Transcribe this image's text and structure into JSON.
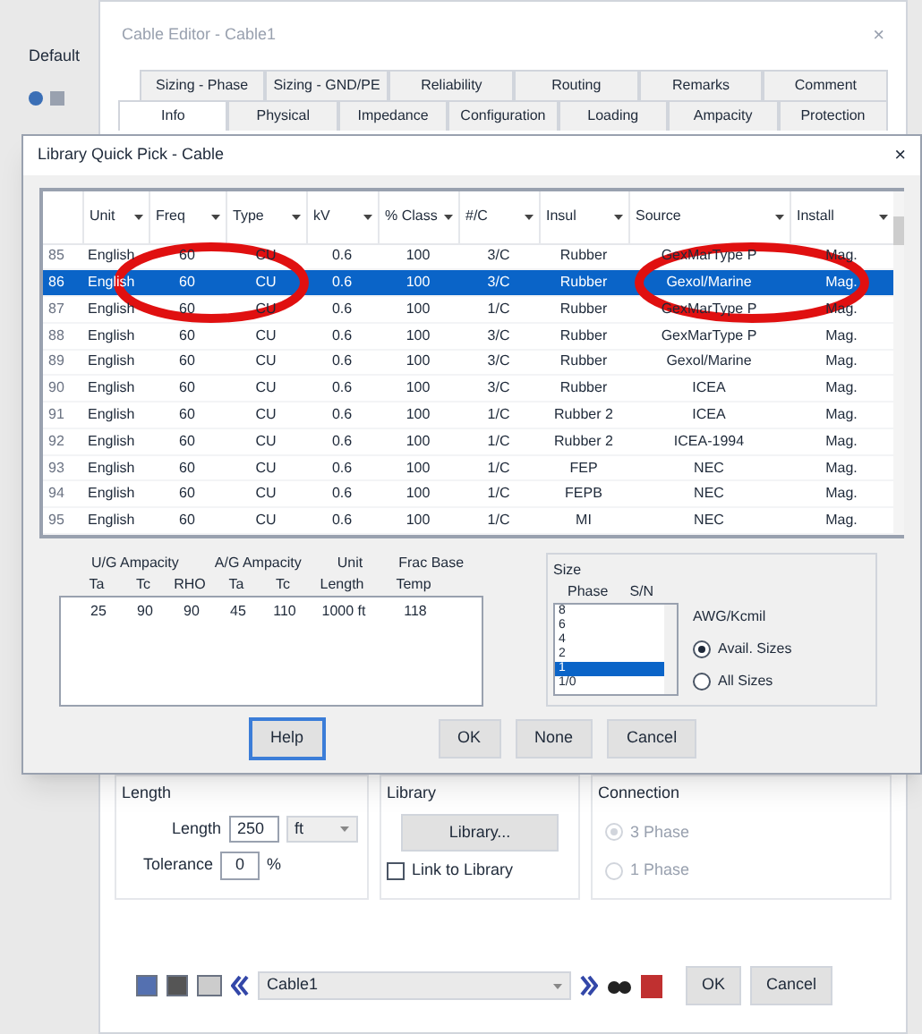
{
  "side": {
    "label": "Default"
  },
  "editor": {
    "title": "Cable Editor - Cable1",
    "close": "×",
    "tab_rows": [
      [
        {
          "label": "Sizing - Phase",
          "selected": false
        },
        {
          "label": "Sizing - GND/PE",
          "selected": false
        },
        {
          "label": "Reliability",
          "selected": false
        },
        {
          "label": "Routing",
          "selected": false
        },
        {
          "label": "Remarks",
          "selected": false
        },
        {
          "label": "Comment",
          "selected": false
        }
      ],
      [
        {
          "label": "Info",
          "selected": true
        },
        {
          "label": "Physical",
          "selected": false
        },
        {
          "label": "Impedance",
          "selected": false
        },
        {
          "label": "Configuration",
          "selected": false
        },
        {
          "label": "Loading",
          "selected": false
        },
        {
          "label": "Ampacity",
          "selected": false
        },
        {
          "label": "Protection",
          "selected": false
        }
      ]
    ],
    "length_group": {
      "title": "Length",
      "length_label": "Length",
      "length": "250",
      "unit": "ft",
      "tolerance_label": "Tolerance",
      "tolerance": "0",
      "tolerance_unit": "%"
    },
    "library_group": {
      "title": "Library",
      "button": "Library...",
      "link_label": "Link to Library",
      "link_checked": false
    },
    "connection_group": {
      "title": "Connection",
      "options": [
        {
          "label": "3 Phase",
          "selected": true
        },
        {
          "label": "1 Phase",
          "selected": false
        }
      ]
    },
    "toolbar": {
      "cable": "Cable1",
      "buttons": [
        "OK",
        "Cancel"
      ]
    }
  },
  "dialog": {
    "title": "Library Quick Pick - Cable",
    "close": "×",
    "columns": [
      "Unit",
      "Freq",
      "Type",
      "kV",
      "% Class",
      "#/C",
      "Insul",
      "Source",
      "Install"
    ],
    "rows": [
      {
        "num": "85",
        "cells": [
          "English",
          "60",
          "CU",
          "0.6",
          "100",
          "3/C",
          "Rubber",
          "GexMarType P",
          "Mag."
        ],
        "selected": false
      },
      {
        "num": "86",
        "cells": [
          "English",
          "60",
          "CU",
          "0.6",
          "100",
          "3/C",
          "Rubber",
          "Gexol/Marine",
          "Mag."
        ],
        "selected": true
      },
      {
        "num": "87",
        "cells": [
          "English",
          "60",
          "CU",
          "0.6",
          "100",
          "1/C",
          "Rubber",
          "GexMarType P",
          "Mag."
        ],
        "selected": false
      },
      {
        "num": "88",
        "cells": [
          "English",
          "60",
          "CU",
          "0.6",
          "100",
          "3/C",
          "Rubber",
          "GexMarType P",
          "Mag."
        ],
        "selected": false
      },
      {
        "num": "89",
        "cells": [
          "English",
          "60",
          "CU",
          "0.6",
          "100",
          "3/C",
          "Rubber",
          "Gexol/Marine",
          "Mag."
        ],
        "selected": false
      },
      {
        "num": "90",
        "cells": [
          "English",
          "60",
          "CU",
          "0.6",
          "100",
          "3/C",
          "Rubber",
          "ICEA",
          "Mag."
        ],
        "selected": false
      },
      {
        "num": "91",
        "cells": [
          "English",
          "60",
          "CU",
          "0.6",
          "100",
          "1/C",
          "Rubber 2",
          "ICEA",
          "Mag."
        ],
        "selected": false
      },
      {
        "num": "92",
        "cells": [
          "English",
          "60",
          "CU",
          "0.6",
          "100",
          "1/C",
          "Rubber 2",
          "ICEA-1994",
          "Mag."
        ],
        "selected": false
      },
      {
        "num": "93",
        "cells": [
          "English",
          "60",
          "CU",
          "0.6",
          "100",
          "1/C",
          "FEP",
          "NEC",
          "Mag."
        ],
        "selected": false
      },
      {
        "num": "94",
        "cells": [
          "English",
          "60",
          "CU",
          "0.6",
          "100",
          "1/C",
          "FEPB",
          "NEC",
          "Mag."
        ],
        "selected": false
      },
      {
        "num": "95",
        "cells": [
          "English",
          "60",
          "CU",
          "0.6",
          "100",
          "1/C",
          "MI",
          "NEC",
          "Mag."
        ],
        "selected": false
      }
    ],
    "ampacity": {
      "groups": [
        "U/G Ampacity",
        "A/G Ampacity",
        "Unit",
        "Frac Base"
      ],
      "columns": [
        "Ta",
        "Tc",
        "RHO",
        "Ta",
        "Tc",
        "Length",
        "Temp"
      ],
      "values": [
        "25",
        "90",
        "90",
        "45",
        "110",
        "1000 ft",
        "118"
      ]
    },
    "size": {
      "title": "Size",
      "headers": [
        "Phase",
        "S/N"
      ],
      "items": [
        {
          "label": "8",
          "selected": false
        },
        {
          "label": "6",
          "selected": false
        },
        {
          "label": "4",
          "selected": false
        },
        {
          "label": "2",
          "selected": false
        },
        {
          "label": "1",
          "selected": true
        },
        {
          "label": "1/0",
          "selected": false
        }
      ],
      "unit_label": "AWG/Kcmil",
      "options": [
        {
          "label": "Avail. Sizes",
          "selected": true
        },
        {
          "label": "All Sizes",
          "selected": false
        }
      ]
    },
    "buttons": [
      {
        "label": "Help",
        "kind": "focused"
      },
      {
        "label": "OK",
        "kind": "normal"
      },
      {
        "label": "None",
        "kind": "normal"
      },
      {
        "label": "Cancel",
        "kind": "normal"
      }
    ]
  },
  "annotations": [
    {
      "kind": "ellipse"
    },
    {
      "kind": "ellipse"
    }
  ]
}
